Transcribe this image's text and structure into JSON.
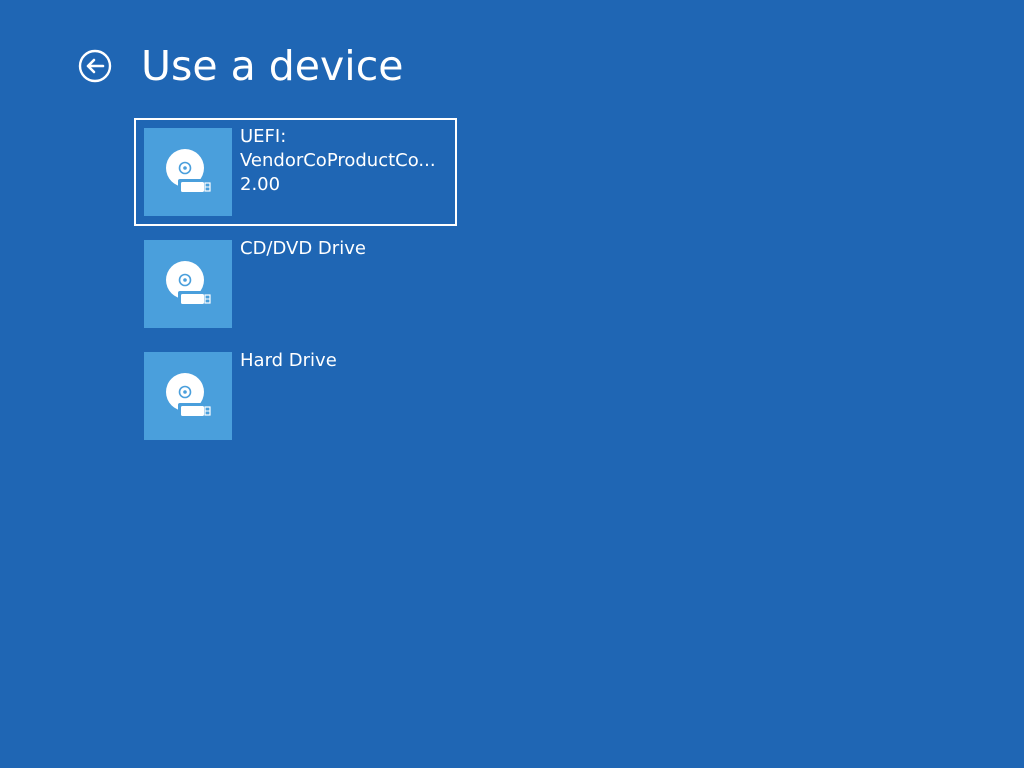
{
  "page": {
    "title": "Use a device",
    "background_color": "#1f66b4",
    "tile_color": "#4a9fdc"
  },
  "header": {
    "back_icon": "back-arrow-circle-icon"
  },
  "devices": [
    {
      "icon": "usb-drive-disc-icon",
      "label_lines": [
        "UEFI:",
        "VendorCoProductCo...",
        "2.00"
      ],
      "selected": true
    },
    {
      "icon": "usb-drive-disc-icon",
      "label_lines": [
        "CD/DVD Drive"
      ],
      "selected": false
    },
    {
      "icon": "usb-drive-disc-icon",
      "label_lines": [
        "Hard Drive"
      ],
      "selected": false
    }
  ]
}
